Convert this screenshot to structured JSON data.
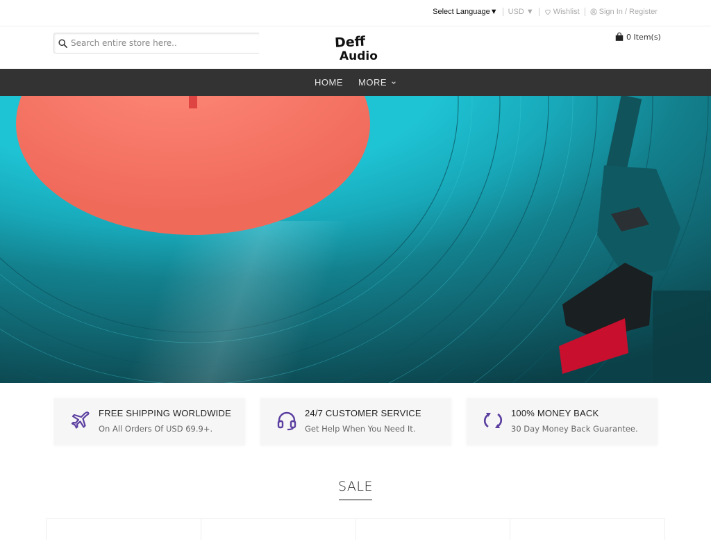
{
  "topbar": {
    "language": "Select Language",
    "language_arrow": "▼",
    "currency": "USD",
    "currency_arrow": "▼",
    "wishlist": "Wishlist",
    "signin": "Sign In / Register"
  },
  "header": {
    "search_placeholder": "Search entire store here..",
    "logo_line1": "Deff",
    "logo_line2": "Audio",
    "cart_label": "0 Item(s)"
  },
  "nav": {
    "items": [
      {
        "label": "HOME"
      },
      {
        "label": "MORE"
      }
    ]
  },
  "hero": {
    "image_description": "vinyl record on turntable"
  },
  "features": [
    {
      "icon": "airplane-icon",
      "title": "FREE SHIPPING WORLDWIDE",
      "desc": "On All Orders Of USD 69.9+."
    },
    {
      "icon": "headset-icon",
      "title": "24/7 CUSTOMER SERVICE",
      "desc": "Get Help When You Need It."
    },
    {
      "icon": "refresh-icon",
      "title": "100% MONEY BACK",
      "desc": "30 Day Money Back Guarantee."
    }
  ],
  "sale": {
    "title": "SALE"
  },
  "colors": {
    "accent": "#5b3fa0",
    "nav_bg": "#333333",
    "feature_bg": "#f6f6f6"
  }
}
